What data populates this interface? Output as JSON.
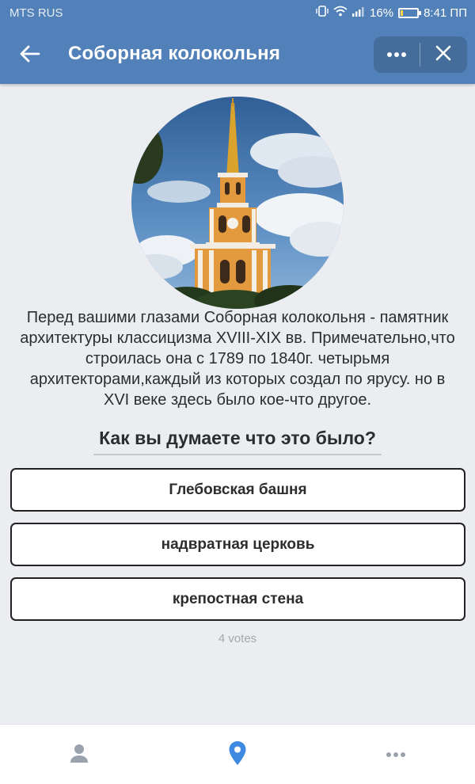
{
  "status_bar": {
    "carrier": "MTS RUS",
    "battery": "16%",
    "time": "8:41 ПП",
    "battery_level": 0.16
  },
  "header": {
    "title": "Соборная колокольня",
    "back_icon": "arrow-left-icon",
    "more_icon": "more-horizontal-icon",
    "close_icon": "close-icon",
    "color": "#5181b8"
  },
  "content": {
    "image_icon": "bell-tower-photo",
    "description": "Перед вашими глазами Соборная колокольня - памятник архитектуры классицизма XVIII-XIX вв. Примечательно,что строилась она с 1789 по 1840г. четырьмя архитекторами,каждый из которых создал по ярусу. но в XVI веке здесь было кое-что другое.",
    "question": "Как вы думаете что это было?",
    "options": [
      {
        "label": "Глебовская башня"
      },
      {
        "label": "надвратная церковь"
      },
      {
        "label": "крепостная стена"
      }
    ],
    "votes": "4 votes"
  },
  "bottom_nav": {
    "items": [
      "profile-icon",
      "location-pin-icon",
      "more-horizontal-icon"
    ],
    "active_color": "#3f8ae0",
    "inactive_color": "#99a2ad"
  }
}
